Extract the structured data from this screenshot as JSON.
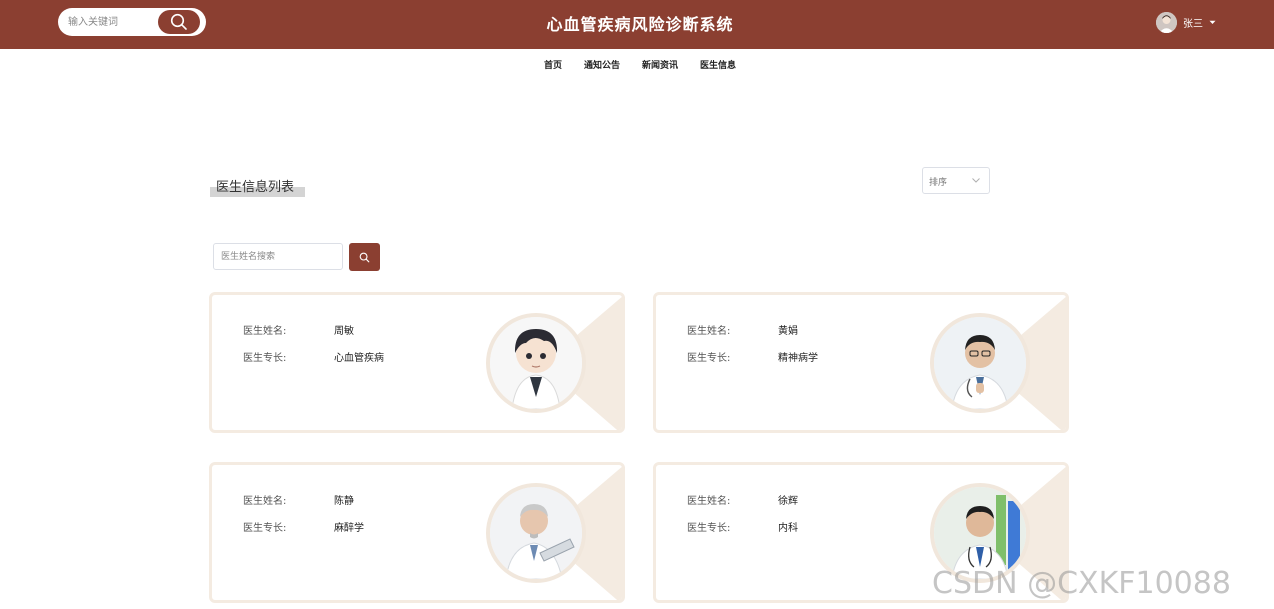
{
  "header": {
    "title": "心血管疾病风险诊断系统",
    "search_placeholder": "输入关键词",
    "username": "张三",
    "brand_color": "#8b3f31"
  },
  "nav": [
    "首页",
    "通知公告",
    "新闻资讯",
    "医生信息"
  ],
  "section": {
    "title": "医生信息列表",
    "sort_label": "排序",
    "name_search_placeholder": "医生姓名搜索"
  },
  "doctor_labels": {
    "name": "医生姓名:",
    "specialty": "医生专长:"
  },
  "doctors": [
    {
      "name": "周敏",
      "specialty": "心血管疾病",
      "photo": "cartoon-doctor-avatar"
    },
    {
      "name": "黄娟",
      "specialty": "精神病学",
      "photo": "doctor-photo-glasses"
    },
    {
      "name": "陈静",
      "specialty": "麻醉学",
      "photo": "doctor-photo-clipboard"
    },
    {
      "name": "徐辉",
      "specialty": "内科",
      "photo": "doctor-photo-stethoscope"
    }
  ],
  "watermark": "CSDN @CXKF10088"
}
